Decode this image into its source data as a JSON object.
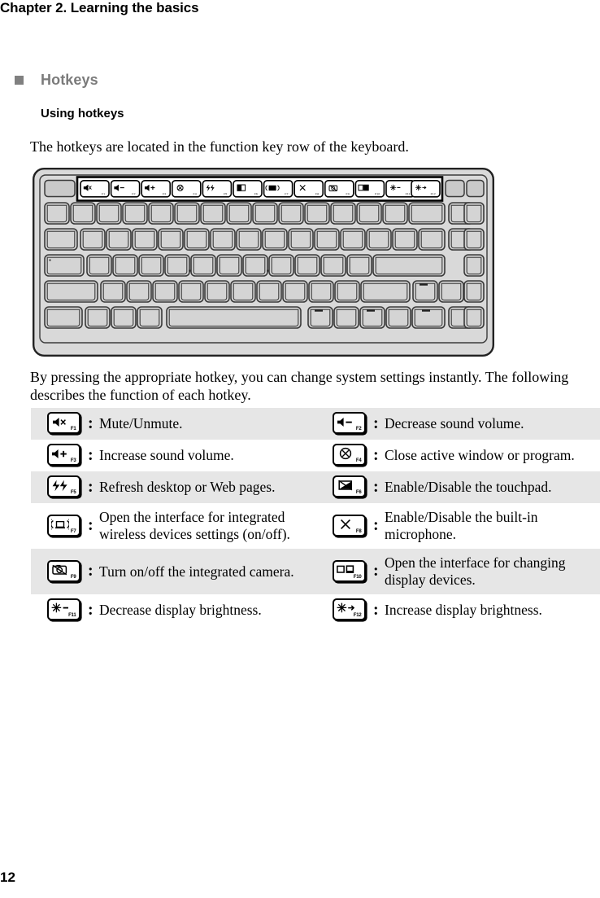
{
  "header": {
    "chapter_title": "Chapter 2. Learning the basics"
  },
  "section": {
    "bullet": "square-bullet",
    "title": "Hotkeys"
  },
  "subsection": {
    "title": "Using hotkeys"
  },
  "paragraphs": {
    "intro": "The hotkeys are located in the function key row of the keyboard.",
    "after_figure": "By pressing the appropriate hotkey, you can change system settings instantly. The following describes the function of each hotkey."
  },
  "figure": {
    "name": "laptop-keyboard-diagram",
    "callout": "function-key-row-highlight",
    "function_keys": [
      "F1",
      "F2",
      "F3",
      "F4",
      "F5",
      "F6",
      "F7",
      "F8",
      "F9",
      "F10",
      "F11",
      "F12"
    ]
  },
  "hotkey_table": {
    "colon": ":",
    "rows": [
      {
        "shaded": true,
        "left": {
          "key": "F1",
          "icon": "mute-icon",
          "desc": "Mute/Unmute."
        },
        "right": {
          "key": "F2",
          "icon": "volume-down-icon",
          "desc": "Decrease sound volume."
        }
      },
      {
        "shaded": false,
        "left": {
          "key": "F3",
          "icon": "volume-up-icon",
          "desc": "Increase sound volume."
        },
        "right": {
          "key": "F4",
          "icon": "close-window-icon",
          "desc": "Close active window or program."
        }
      },
      {
        "shaded": true,
        "left": {
          "key": "F5",
          "icon": "refresh-icon",
          "desc": "Refresh desktop or Web pages."
        },
        "right": {
          "key": "F6",
          "icon": "touchpad-toggle-icon",
          "desc": "Enable/Disable the touchpad."
        }
      },
      {
        "shaded": false,
        "left": {
          "key": "F7",
          "icon": "wireless-icon",
          "desc": "Open the interface for integrated wireless devices settings (on/off)."
        },
        "right": {
          "key": "F8",
          "icon": "microphone-toggle-icon",
          "desc": "Enable/Disable the built-in microphone."
        }
      },
      {
        "shaded": true,
        "left": {
          "key": "F9",
          "icon": "camera-icon",
          "desc": "Turn on/off the integrated camera."
        },
        "right": {
          "key": "F10",
          "icon": "display-switch-icon",
          "desc": "Open the interface for changing display devices."
        }
      },
      {
        "shaded": false,
        "left": {
          "key": "F11",
          "icon": "brightness-down-icon",
          "desc": "Decrease display brightness."
        },
        "right": {
          "key": "F12",
          "icon": "brightness-up-icon",
          "desc": "Increase display brightness."
        }
      }
    ]
  },
  "footer": {
    "page_number": "12"
  },
  "colors": {
    "shaded_row": "#e6e6e6",
    "section_heading": "#7b7b7b",
    "bullet": "#808080",
    "keyboard_body": "#d9d9d9",
    "keycap_fill": "#d4d4d4",
    "text": "#000000"
  }
}
